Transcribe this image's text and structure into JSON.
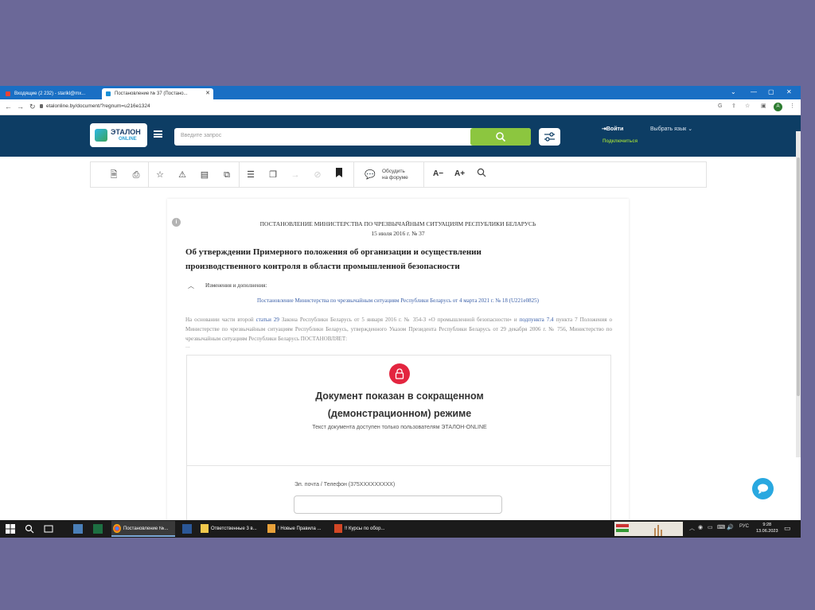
{
  "browser": {
    "tabs": [
      {
        "label": "Входящие (2 232) - starikl@mx...",
        "active": false
      },
      {
        "label": "Постановление № 37 (Постано...",
        "active": true
      }
    ],
    "url": "etalonline.by/document/?regnum=u216e1324"
  },
  "site": {
    "logo_title": "ЭТАЛОН",
    "logo_sub": "ONLINE",
    "search_placeholder": "Введите запрос",
    "login_label": "Войти",
    "connect_label": "Подключиться",
    "lang_label": "Выбрать язык"
  },
  "toolbar": {
    "forum_label_1": "Обсудить",
    "forum_label_2": "на форуме",
    "font_decrease": "A−",
    "font_increase": "A+"
  },
  "document": {
    "issuer": "ПОСТАНОВЛЕНИЕ МИНИСТЕРСТВА ПО ЧРЕЗВЫЧАЙНЫМ СИТУАЦИЯМ РЕСПУБЛИКИ БЕЛАРУСЬ",
    "date_number": "15 июля 2016 г. № 37",
    "title": "Об утверждении Примерного положения об организации и осуществлении производственного контроля в области промышленной безопасности",
    "changes_label": "Изменения и дополнения:",
    "changes_link": "Постановление Министерства по чрезвычайным ситуациям Республики Беларусь от 4 марта 2021 г. № 18 (U221e0825)",
    "para_1": "На основании части второй ",
    "para_link_1": "статьи 29",
    "para_2": " Закона Республики Беларусь от 5 января 2016 г. № 354-З «О промышленной безопасности» и ",
    "para_link_2": "подпункта 7.4",
    "para_3": " пункта 7 Положения о Министерстве по чрезвычайным ситуациям Республики Беларусь, утвержденного Указом Президента Республики Беларусь от 29 декабря 2006 г. № 756, Министерство по чрезвычайным ситуациям Республики Беларусь ПОСТАНОВЛЯЕТ:",
    "ellipsis": "...",
    "demo_title_1": "Документ показан в сокращенном",
    "demo_title_2": "(демонстрационном) режиме",
    "demo_sub": "Текст документа доступен только пользователям ЭТАЛОН-ONLINE",
    "form_label": "Эл. почта / Телефон (375XXXXXXXXX)"
  },
  "taskbar": {
    "tasks": [
      {
        "label": "Постановление №..."
      },
      {
        "label": "Ответственные 3 в..."
      },
      {
        "label": "! Новые Правила ..."
      },
      {
        "label": "!! Курсы  по обор..."
      }
    ],
    "lang": "РУС",
    "time": "9:28",
    "date": "13.06.2023"
  },
  "colors": {
    "outer_bg": "#6b6898",
    "browser_tabs": "#1a6fc4",
    "site_header": "#0d3d64",
    "accent_green": "#8cc63f",
    "lock_red": "#e3253f",
    "chat_blue": "#29a8e0",
    "link_blue": "#3a5fa8"
  },
  "icons": [
    "gmail-icon",
    "etalon-tab-icon",
    "back-icon",
    "forward-icon",
    "reload-icon",
    "lock-icon",
    "google-icon",
    "share-icon",
    "star-icon",
    "extension-icon",
    "menu-dots-icon",
    "hamburger-icon",
    "search-icon",
    "filter-icon",
    "login-icon",
    "chevron-down-icon",
    "save-icon",
    "print-icon",
    "favorite-icon",
    "warning-icon",
    "card-icon",
    "compare-icon",
    "list-icon",
    "copy-icon",
    "export-icon",
    "cancel-icon",
    "bookmark-icon",
    "chat-bubble-icon",
    "magnifier-icon",
    "info-icon",
    "chevron-up-icon",
    "padlock-icon",
    "chat-icon",
    "windows-icon",
    "taskbar-search-icon",
    "task-view-icon"
  ]
}
